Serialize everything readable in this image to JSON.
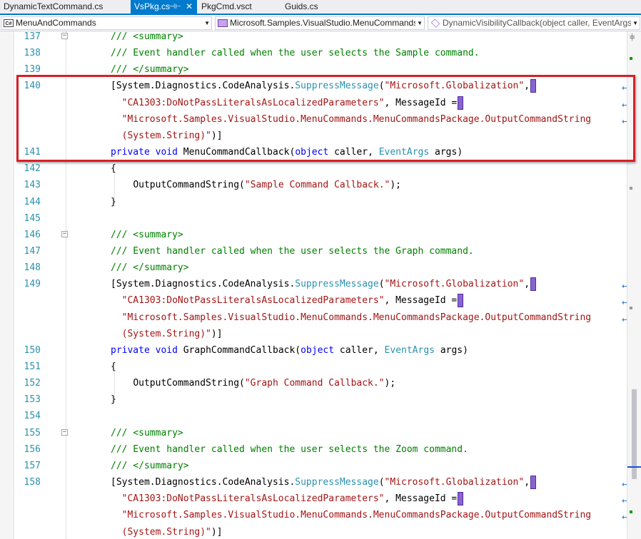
{
  "tabs": [
    {
      "label": "DynamicTextCommand.cs",
      "active": false
    },
    {
      "label": "VsPkg.cs",
      "active": true,
      "pin": "⊣⊢",
      "close": "✕"
    },
    {
      "label": "PkgCmd.vsct",
      "active": false
    },
    {
      "label": "Guids.cs",
      "active": false
    }
  ],
  "nav": {
    "project": {
      "icon": "C#",
      "label": "MenuAndCommands"
    },
    "type": {
      "label": "Microsoft.Samples.VisualStudio.MenuCommands."
    },
    "member": {
      "label": "DynamicVisibilityCallback(object caller, EventArgs"
    }
  },
  "editor": {
    "lines": [
      {
        "num": "137",
        "fold": "−",
        "tokens": [
          {
            "t": "/// <summary>",
            "c": "cm"
          }
        ]
      },
      {
        "num": "138",
        "tokens": [
          {
            "t": "/// Event handler called when the user selects the Sample command.",
            "c": "cm"
          }
        ]
      },
      {
        "num": "139",
        "tokens": [
          {
            "t": "/// </summary>",
            "c": "cm"
          }
        ]
      },
      {
        "num": "140",
        "tokens": [
          {
            "t": "[System.Diagnostics.CodeAnalysis.",
            "c": ""
          },
          {
            "t": "SuppressMessage",
            "c": "ty"
          },
          {
            "t": "(",
            "c": ""
          },
          {
            "t": "\"Microsoft.Globalization\"",
            "c": "st"
          },
          {
            "t": ",",
            "c": ""
          }
        ],
        "marker": true,
        "wrap": "↩"
      },
      {
        "num": "",
        "indent": "  ",
        "tokens": [
          {
            "t": "\"CA1303:DoNotPassLiteralsAsLocalizedParameters\"",
            "c": "st"
          },
          {
            "t": ", MessageId =",
            "c": ""
          }
        ],
        "marker": true,
        "wrap": "↩"
      },
      {
        "num": "",
        "indent": "  ",
        "tokens": [
          {
            "t": "\"Microsoft.Samples.VisualStudio.MenuCommands.MenuCommandsPackage.OutputCommandString",
            "c": "st"
          }
        ],
        "wrap": "↩"
      },
      {
        "num": "",
        "indent": "  ",
        "tokens": [
          {
            "t": "(System.String)\"",
            "c": "st"
          },
          {
            "t": ")]",
            "c": ""
          }
        ]
      },
      {
        "num": "141",
        "tokens": [
          {
            "t": "private",
            "c": "kw"
          },
          {
            "t": " ",
            "c": ""
          },
          {
            "t": "void",
            "c": "kw"
          },
          {
            "t": " MenuCommandCallback(",
            "c": ""
          },
          {
            "t": "object",
            "c": "kw"
          },
          {
            "t": " caller, ",
            "c": ""
          },
          {
            "t": "EventArgs",
            "c": "ty"
          },
          {
            "t": " args)",
            "c": ""
          }
        ]
      },
      {
        "num": "142",
        "tokens": [
          {
            "t": "{",
            "c": ""
          }
        ]
      },
      {
        "num": "143",
        "indent": "    ",
        "tokens": [
          {
            "t": "OutputCommandString(",
            "c": ""
          },
          {
            "t": "\"Sample Command Callback.\"",
            "c": "st"
          },
          {
            "t": ");",
            "c": ""
          }
        ]
      },
      {
        "num": "144",
        "tokens": [
          {
            "t": "}",
            "c": ""
          }
        ]
      },
      {
        "num": "145",
        "tokens": []
      },
      {
        "num": "146",
        "fold": "−",
        "tokens": [
          {
            "t": "/// <summary>",
            "c": "cm"
          }
        ]
      },
      {
        "num": "147",
        "tokens": [
          {
            "t": "/// Event handler called when the user selects the Graph command.",
            "c": "cm"
          }
        ]
      },
      {
        "num": "148",
        "tokens": [
          {
            "t": "/// </summary>",
            "c": "cm"
          }
        ]
      },
      {
        "num": "149",
        "tokens": [
          {
            "t": "[System.Diagnostics.CodeAnalysis.",
            "c": ""
          },
          {
            "t": "SuppressMessage",
            "c": "ty"
          },
          {
            "t": "(",
            "c": ""
          },
          {
            "t": "\"Microsoft.Globalization\"",
            "c": "st"
          },
          {
            "t": ",",
            "c": ""
          }
        ],
        "marker": true,
        "wrap": "↩"
      },
      {
        "num": "",
        "indent": "  ",
        "tokens": [
          {
            "t": "\"CA1303:DoNotPassLiteralsAsLocalizedParameters\"",
            "c": "st"
          },
          {
            "t": ", MessageId =",
            "c": ""
          }
        ],
        "marker": true,
        "wrap": "↩"
      },
      {
        "num": "",
        "indent": "  ",
        "tokens": [
          {
            "t": "\"Microsoft.Samples.VisualStudio.MenuCommands.MenuCommandsPackage.OutputCommandString",
            "c": "st"
          }
        ],
        "wrap": "↩"
      },
      {
        "num": "",
        "indent": "  ",
        "tokens": [
          {
            "t": "(System.String)\"",
            "c": "st"
          },
          {
            "t": ")]",
            "c": ""
          }
        ]
      },
      {
        "num": "150",
        "tokens": [
          {
            "t": "private",
            "c": "kw"
          },
          {
            "t": " ",
            "c": ""
          },
          {
            "t": "void",
            "c": "kw"
          },
          {
            "t": " GraphCommandCallback(",
            "c": ""
          },
          {
            "t": "object",
            "c": "kw"
          },
          {
            "t": " caller, ",
            "c": ""
          },
          {
            "t": "EventArgs",
            "c": "ty"
          },
          {
            "t": " args)",
            "c": ""
          }
        ]
      },
      {
        "num": "151",
        "tokens": [
          {
            "t": "{",
            "c": ""
          }
        ]
      },
      {
        "num": "152",
        "indent": "    ",
        "tokens": [
          {
            "t": "OutputCommandString(",
            "c": ""
          },
          {
            "t": "\"Graph Command Callback.\"",
            "c": "st"
          },
          {
            "t": ");",
            "c": ""
          }
        ]
      },
      {
        "num": "153",
        "tokens": [
          {
            "t": "}",
            "c": ""
          }
        ]
      },
      {
        "num": "154",
        "tokens": []
      },
      {
        "num": "155",
        "fold": "−",
        "tokens": [
          {
            "t": "/// <summary>",
            "c": "cm"
          }
        ]
      },
      {
        "num": "156",
        "tokens": [
          {
            "t": "/// Event handler called when the user selects the Zoom command.",
            "c": "cm"
          }
        ]
      },
      {
        "num": "157",
        "tokens": [
          {
            "t": "/// </summary>",
            "c": "cm"
          }
        ]
      },
      {
        "num": "158",
        "tokens": [
          {
            "t": "[System.Diagnostics.CodeAnalysis.",
            "c": ""
          },
          {
            "t": "SuppressMessage",
            "c": "ty"
          },
          {
            "t": "(",
            "c": ""
          },
          {
            "t": "\"Microsoft.Globalization\"",
            "c": "st"
          },
          {
            "t": ",",
            "c": ""
          }
        ],
        "marker": true,
        "wrap": "↩"
      },
      {
        "num": "",
        "indent": "  ",
        "tokens": [
          {
            "t": "\"CA1303:DoNotPassLiteralsAsLocalizedParameters\"",
            "c": "st"
          },
          {
            "t": ", MessageId =",
            "c": ""
          }
        ],
        "marker": true,
        "wrap": "↩"
      },
      {
        "num": "",
        "indent": "  ",
        "tokens": [
          {
            "t": "\"Microsoft.Samples.VisualStudio.MenuCommands.MenuCommandsPackage.OutputCommandString",
            "c": "st"
          }
        ],
        "wrap": "↩"
      },
      {
        "num": "",
        "indent": "  ",
        "tokens": [
          {
            "t": "(System.String)\"",
            "c": "st"
          },
          {
            "t": ")]",
            "c": ""
          }
        ]
      }
    ]
  },
  "colors": {
    "accent": "#007acc",
    "comment": "#008000",
    "keyword": "#0000ff",
    "type": "#2b91af",
    "string": "#a31515",
    "highlight_border": "#d81f26",
    "marker": "#8a63d2"
  },
  "scrollbar": {
    "split_icon": "⫩"
  }
}
